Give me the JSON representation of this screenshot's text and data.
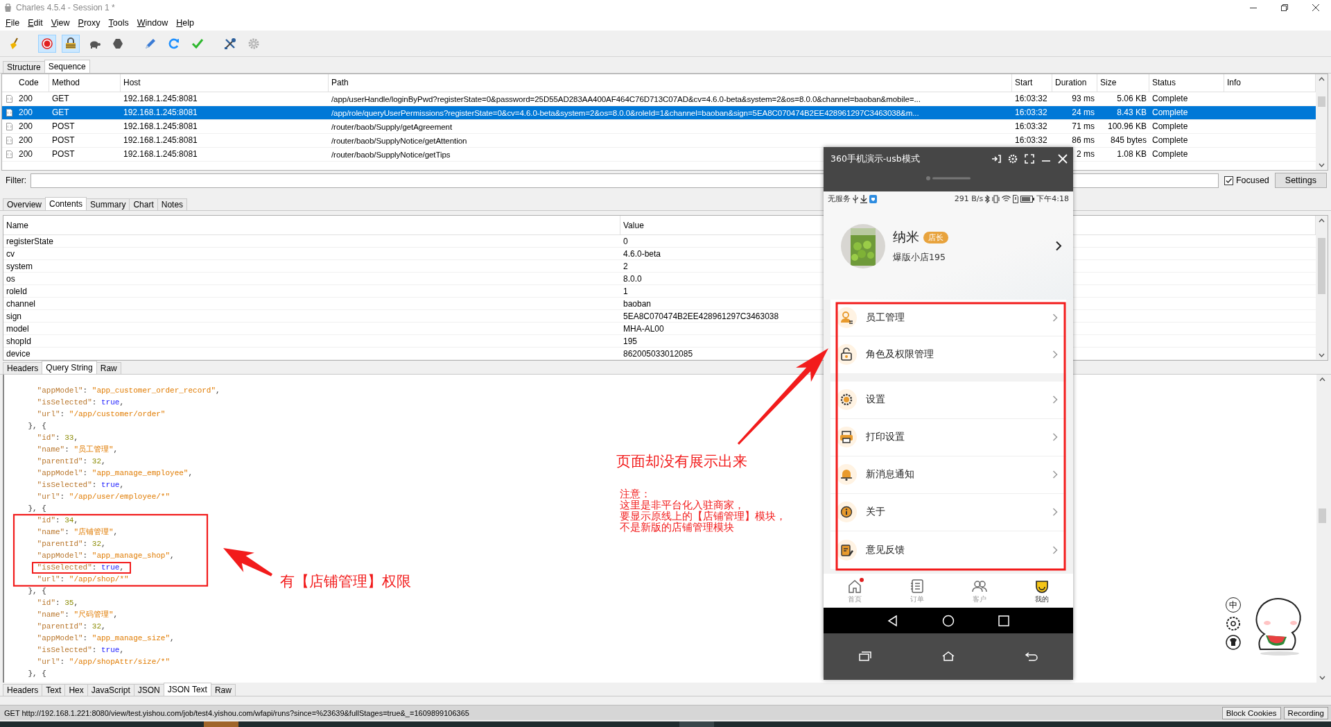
{
  "window": {
    "title": "Charles 4.5.4 - Session 1 *"
  },
  "menu": [
    "File",
    "Edit",
    "View",
    "Proxy",
    "Tools",
    "Window",
    "Help"
  ],
  "toolbar": [
    {
      "kind": "broom",
      "on": false
    },
    {
      "kind": "record",
      "on": true
    },
    {
      "kind": "throttle",
      "on": true
    },
    {
      "kind": "turtle",
      "on": false
    },
    {
      "kind": "stop",
      "on": false
    },
    {
      "kind": "pen",
      "on": false
    },
    {
      "kind": "repeat",
      "on": false
    },
    {
      "kind": "validate",
      "on": false
    },
    {
      "kind": "tools",
      "on": false
    },
    {
      "kind": "settings",
      "on": false
    }
  ],
  "view_tabs": [
    {
      "label": "Structure",
      "selected": false
    },
    {
      "label": "Sequence",
      "selected": true
    }
  ],
  "sequence": {
    "columns": [
      "Code",
      "Method",
      "Host",
      "Path",
      "Start",
      "Duration",
      "Size",
      "Status",
      "Info"
    ],
    "rows": [
      {
        "code": "200",
        "method": "GET",
        "host": "192.168.1.245:8081",
        "path": "/app/userHandle/loginByPwd?registerState=0&password=25D55AD283AA400AF464C76D713C07AD&cv=4.6.0-beta&system=2&os=8.0.0&channel=baoban&mobile=...",
        "start": "16:03:32",
        "duration": "93 ms",
        "size": "5.06 KB",
        "status": "Complete",
        "selected": false
      },
      {
        "code": "200",
        "method": "GET",
        "host": "192.168.1.245:8081",
        "path": "/app/role/queryUserPermissions?registerState=0&cv=4.6.0-beta&system=2&os=8.0.0&roleId=1&channel=baoban&sign=5EA8C070474B2EE428961297C3463038&m...",
        "start": "16:03:32",
        "duration": "24 ms",
        "size": "8.43 KB",
        "status": "Complete",
        "selected": true
      },
      {
        "code": "200",
        "method": "POST",
        "host": "192.168.1.245:8081",
        "path": "/router/baob/Supply/getAgreement",
        "start": "16:03:32",
        "duration": "71 ms",
        "size": "100.96 KB",
        "status": "Complete",
        "selected": false
      },
      {
        "code": "200",
        "method": "POST",
        "host": "192.168.1.245:8081",
        "path": "/router/baob/SupplyNotice/getAttention",
        "start": "16:03:32",
        "duration": "86 ms",
        "size": "845 bytes",
        "status": "Complete",
        "selected": false
      },
      {
        "code": "200",
        "method": "POST",
        "host": "192.168.1.245:8081",
        "path": "/router/baob/SupplyNotice/getTips",
        "duration": "2 ms",
        "size": "1.08 KB",
        "status": "Complete",
        "selected": false
      }
    ]
  },
  "filter": {
    "label": "Filter:",
    "focused_label": "Focused",
    "focused": true,
    "settings_button": "Settings"
  },
  "detail_tabs": [
    {
      "label": "Overview",
      "selected": false
    },
    {
      "label": "Contents",
      "selected": true
    },
    {
      "label": "Summary",
      "selected": false
    },
    {
      "label": "Chart",
      "selected": false
    },
    {
      "label": "Notes",
      "selected": false
    }
  ],
  "query": {
    "columns": [
      "Name",
      "Value"
    ],
    "rows": [
      {
        "name": "registerState",
        "value": "0"
      },
      {
        "name": "cv",
        "value": "4.6.0-beta"
      },
      {
        "name": "system",
        "value": "2"
      },
      {
        "name": "os",
        "value": "8.0.0"
      },
      {
        "name": "roleId",
        "value": "1"
      },
      {
        "name": "channel",
        "value": "baoban"
      },
      {
        "name": "sign",
        "value": "5EA8C070474B2EE428961297C3463038"
      },
      {
        "name": "model",
        "value": "MHA-AL00"
      },
      {
        "name": "shopId",
        "value": "195"
      },
      {
        "name": "device",
        "value": "862005033012085"
      }
    ]
  },
  "request_tabs": [
    {
      "label": "Headers",
      "selected": false
    },
    {
      "label": "Query String",
      "selected": true
    },
    {
      "label": "Raw",
      "selected": false
    }
  ],
  "response_lines": [
    "      \"appModel\": \"app_customer_order_record\",",
    "      \"isSelected\": true,",
    "      \"url\": \"/app/customer/order\"",
    "    }, {",
    "      \"id\": 33,",
    "      \"name\": \"员工管理\",",
    "      \"parentId\": 32,",
    "      \"appModel\": \"app_manage_employee\",",
    "      \"isSelected\": true,",
    "      \"url\": \"/app/user/employee/*\"",
    "    }, {",
    "      \"id\": 34,",
    "      \"name\": \"店铺管理\",",
    "      \"parentId\": 32,",
    "      \"appModel\": \"app_manage_shop\",",
    "      \"isSelected\": true,",
    "      \"url\": \"/app/shop/*\"",
    "    }, {",
    "      \"id\": 35,",
    "      \"name\": \"尺码管理\",",
    "      \"parentId\": 32,",
    "      \"appModel\": \"app_manage_size\",",
    "      \"isSelected\": true,",
    "      \"url\": \"/app/shopAttr/size/*\"",
    "    }, {"
  ],
  "response_tabs": [
    {
      "label": "Headers",
      "selected": false
    },
    {
      "label": "Text",
      "selected": false
    },
    {
      "label": "Hex",
      "selected": false
    },
    {
      "label": "JavaScript",
      "selected": false
    },
    {
      "label": "JSON",
      "selected": false
    },
    {
      "label": "JSON Text",
      "selected": true
    },
    {
      "label": "Raw",
      "selected": false
    }
  ],
  "status_bar": {
    "text": "GET http://192.168.1.221:8080/view/test.yishou.com/job/test4.yishou.com/wfapi/runs?since=%23639&fullStages=true&_=1609899106365",
    "buttons": [
      "Block Cookies",
      "Recording"
    ]
  },
  "phone": {
    "title": "360手机演示-usb模式",
    "status_left": "无服务",
    "status_speed": "291 B/s",
    "status_time": "下午4:18",
    "profile": {
      "name": "纳米",
      "badge": "店长",
      "shop": "爆版小店195"
    },
    "menu_groups": [
      [
        {
          "label": "员工管理",
          "kind": "employee"
        },
        {
          "label": "角色及权限管理",
          "kind": "role"
        }
      ],
      [
        {
          "label": "设置",
          "kind": "settings"
        },
        {
          "label": "打印设置",
          "kind": "print"
        },
        {
          "label": "新消息通知",
          "kind": "notify"
        },
        {
          "label": "关于",
          "kind": "about"
        },
        {
          "label": "意见反馈",
          "kind": "feedback"
        }
      ]
    ],
    "tabbar": [
      {
        "label": "首页",
        "kind": "home",
        "selected": false,
        "dot": true
      },
      {
        "label": "订单",
        "kind": "orders",
        "selected": false,
        "dot": false
      },
      {
        "label": "客户",
        "kind": "customers",
        "selected": false,
        "dot": false
      },
      {
        "label": "我的",
        "kind": "me",
        "selected": true,
        "dot": false
      }
    ]
  },
  "annotations": {
    "permission_callout": "有【店铺管理】权限",
    "missing_callout": "页面却没有展示出来",
    "note": [
      "注意：",
      "这里是非平台化入驻商家，",
      "要显示原线上的【店铺管理】模块，",
      "不是新版的店铺管理模块"
    ]
  },
  "floating_tools": {
    "input_mode": "中"
  }
}
